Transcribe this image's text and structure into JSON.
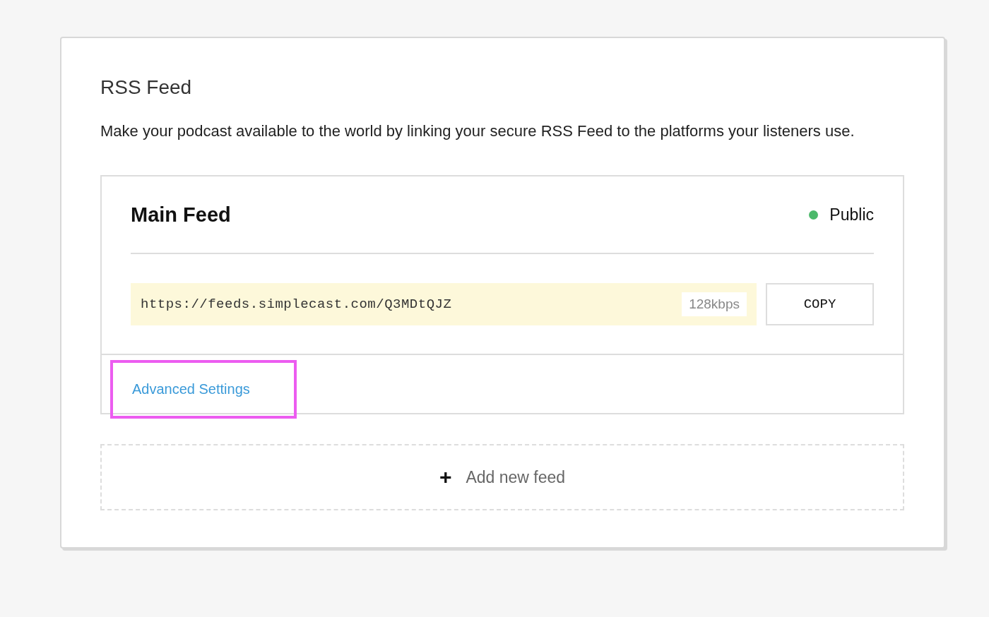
{
  "section": {
    "title": "RSS Feed",
    "description": "Make your podcast available to the world by linking your secure RSS Feed to the platforms your listeners use."
  },
  "feed": {
    "name": "Main Feed",
    "status": {
      "label": "Public",
      "color": "#4cb96b"
    },
    "url": "https://feeds.simplecast.com/Q3MDtQJZ",
    "bitrate": "128kbps",
    "copy_button": "COPY",
    "advanced_link": {
      "label": "Advanced Settings",
      "highlighted": true
    }
  },
  "add_feed": {
    "icon": "+",
    "label": "Add new feed"
  }
}
